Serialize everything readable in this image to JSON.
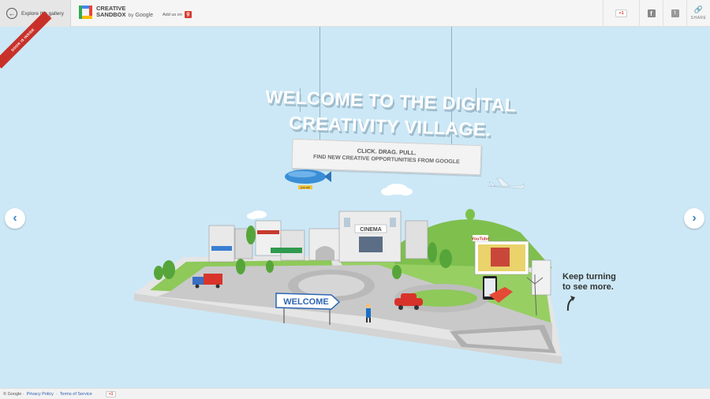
{
  "header": {
    "back_label": "Explore the gallery",
    "logo_line1": "CREATIVE",
    "logo_line2": "SANDBOX",
    "logo_by": "by",
    "logo_google": "Google",
    "add_us_label": "Add us on",
    "gplus_label": "+1",
    "share_label": "SHARE"
  },
  "ribbon": {
    "text": "DOOR IS INSIDE"
  },
  "hero": {
    "title_line1": "WELCOME TO THE DIGITAL",
    "title_line2": "CREATIVITY VILLAGE.",
    "sub_line1": "CLICK. DRAG. PULL.",
    "sub_line2": "FIND NEW CREATIVE OPPORTUNITIES FROM GOOGLE"
  },
  "village": {
    "welcome_sign": "WELCOME",
    "cinema_sign": "CINEMA",
    "youtube_sign": "YouTube",
    "blimp_label": "you are"
  },
  "hint": {
    "line1": "Keep turning",
    "line2": "to see more."
  },
  "footer": {
    "copyright": "© Google ·",
    "privacy": "Privacy Policy",
    "separator": "·",
    "terms": "Terms of Service",
    "gplus": "+1"
  },
  "colors": {
    "sky": "#cce8f6",
    "accent_blue": "#3c86c4",
    "google_red": "#d73d32",
    "grass": "#8ec95a"
  },
  "icons": [
    "back-arrow-icon",
    "google-plus-icon",
    "facebook-icon",
    "twitter-icon",
    "link-icon",
    "chevron-left-icon",
    "chevron-right-icon",
    "curved-arrow-icon"
  ]
}
